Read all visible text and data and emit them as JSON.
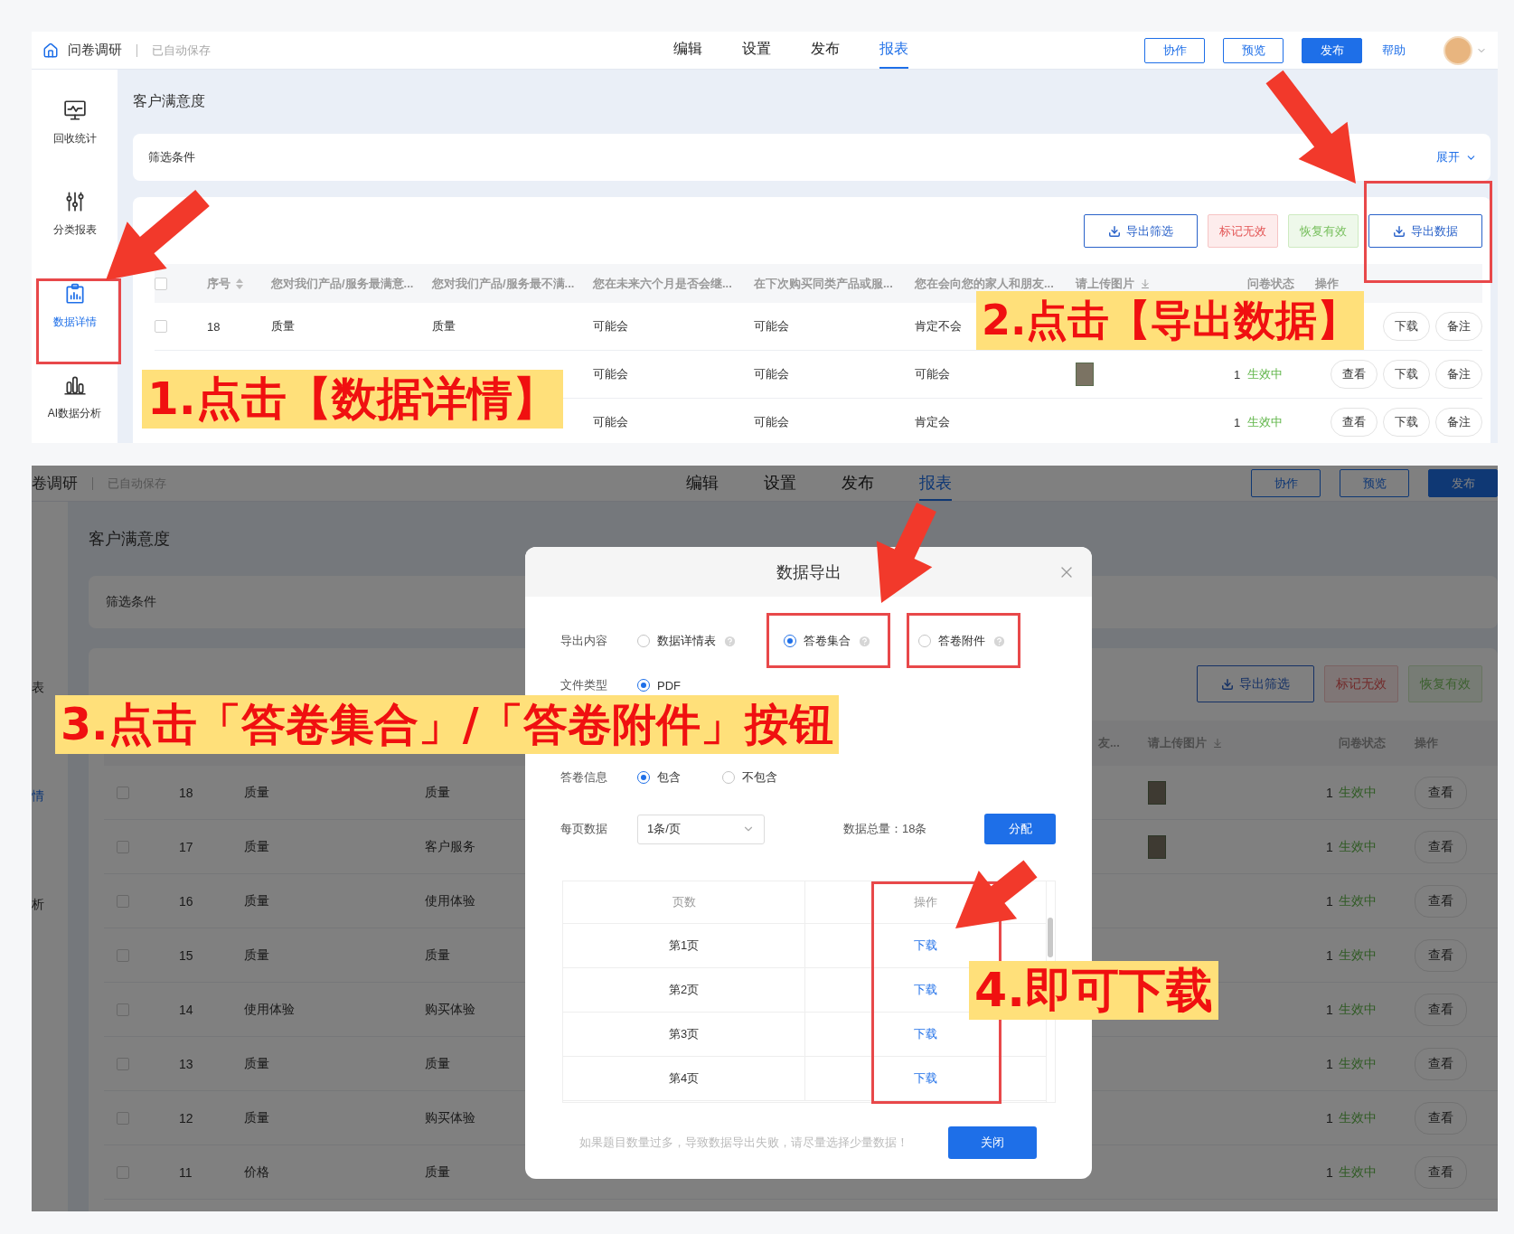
{
  "top_screen": {
    "header": {
      "home_icon": true,
      "title": "问卷调研",
      "autosave": "已自动保存",
      "tabs": [
        {
          "label": "编辑",
          "selected": false
        },
        {
          "label": "设置",
          "selected": false
        },
        {
          "label": "发布",
          "selected": false
        },
        {
          "label": "报表",
          "selected": true
        }
      ],
      "buttons": [
        {
          "label": "协作",
          "kind": "outline"
        },
        {
          "label": "预览",
          "kind": "outline"
        },
        {
          "label": "发布",
          "kind": "primary"
        },
        {
          "label": "帮助",
          "kind": "link"
        }
      ],
      "avatar": true
    },
    "sidebar": {
      "items": [
        {
          "label": "回收统计",
          "selected": false
        },
        {
          "label": "分类报表",
          "selected": false
        },
        {
          "label": "数据详情",
          "selected": true
        },
        {
          "label": "AI数据分析",
          "selected": false
        }
      ]
    },
    "page_title": "客户满意度",
    "filter": {
      "label": "筛选条件",
      "toggle": "展开"
    },
    "toolbar": [
      {
        "label": "导出筛选",
        "kind": "export"
      },
      {
        "label": "标记无效",
        "kind": "danger"
      },
      {
        "label": "恢复有效",
        "kind": "success"
      },
      {
        "label": "导出数据",
        "kind": "export"
      }
    ],
    "table": {
      "checked": false,
      "columns": [
        {
          "label": "序号",
          "kind": "sort"
        },
        {
          "label": "您对我们产品/服务最满意...",
          "kind": "text"
        },
        {
          "label": "您对我们产品/服务最不满...",
          "kind": "text"
        },
        {
          "label": "您在未来六个月是否会继...",
          "kind": "text"
        },
        {
          "label": "在下次购买同类产品或服...",
          "kind": "text"
        },
        {
          "label": "您在会向您的家人和朋友...",
          "kind": "text"
        },
        {
          "label": "请上传图片",
          "kind": "download"
        },
        {
          "label": "问卷状态",
          "kind": "text"
        },
        {
          "label": "操作",
          "kind": "text"
        }
      ],
      "rows": [
        {
          "checked": false,
          "cells": [
            "18",
            "质量",
            "质量",
            "可能会",
            "可能会",
            "肯定不会"
          ],
          "actions": [
            "下载",
            "备注"
          ]
        },
        {
          "cells": [
            null,
            null,
            null,
            "可能会",
            "可能会",
            "可能会"
          ],
          "photo": true,
          "count": "1",
          "status": "生效中",
          "actions": [
            "查看",
            "下载",
            "备注"
          ]
        },
        {
          "cells": [
            null,
            null,
            null,
            "可能会",
            "可能会",
            "肯定会"
          ],
          "count": "1",
          "status": "生效中",
          "actions": [
            "查看",
            "下载",
            "备注"
          ]
        }
      ]
    }
  },
  "bottom_screen": {
    "header": {
      "title": "卷调研",
      "autosave": "已自动保存",
      "tabs": [
        {
          "label": "编辑",
          "selected": false
        },
        {
          "label": "设置",
          "selected": false
        },
        {
          "label": "发布",
          "selected": false
        },
        {
          "label": "报表",
          "selected": true
        }
      ],
      "buttons": [
        {
          "label": "协作",
          "kind": "outline"
        },
        {
          "label": "预览",
          "kind": "outline"
        },
        {
          "label": "发布",
          "kind": "primary"
        }
      ]
    },
    "sidebar": {
      "items": [
        {
          "label": "表",
          "selected": false
        },
        {
          "label": "情",
          "selected": true
        },
        {
          "label": "析",
          "selected": false
        }
      ]
    },
    "page_title": "客户满意度",
    "filter": {
      "label": "筛选条件"
    },
    "toolbar": [
      {
        "label": "导出筛选",
        "kind": "export"
      },
      {
        "label": "标记无效",
        "kind": "danger"
      },
      {
        "label": "恢复有效",
        "kind": "success"
      }
    ],
    "table": {
      "columns": [
        {
          "label": "友...",
          "kind": "text"
        },
        {
          "label": "请上传图片",
          "kind": "download"
        },
        {
          "label": "问卷状态",
          "kind": "text"
        },
        {
          "label": "操作",
          "kind": "text"
        }
      ],
      "rows": [
        {
          "checked": false,
          "cells": [
            "18",
            "质量",
            "质量"
          ],
          "photo": true,
          "count": "1",
          "status": "生效中",
          "actions": [
            "查看"
          ]
        },
        {
          "checked": false,
          "cells": [
            "17",
            "质量",
            "客户服务"
          ],
          "photo": true,
          "count": "1",
          "status": "生效中",
          "actions": [
            "查看"
          ]
        },
        {
          "checked": false,
          "cells": [
            "16",
            "质量",
            "使用体验"
          ],
          "count": "1",
          "status": "生效中",
          "actions": [
            "查看"
          ]
        },
        {
          "checked": false,
          "cells": [
            "15",
            "质量",
            "质量"
          ],
          "count": "1",
          "status": "生效中",
          "actions": [
            "查看"
          ]
        },
        {
          "checked": false,
          "cells": [
            "14",
            "使用体验",
            "购买体验"
          ],
          "count": "1",
          "status": "生效中",
          "actions": [
            "查看"
          ]
        },
        {
          "checked": false,
          "cells": [
            "13",
            "质量",
            "质量"
          ],
          "count": "1",
          "status": "生效中",
          "actions": [
            "查看"
          ]
        },
        {
          "checked": false,
          "cells": [
            "12",
            "质量",
            "购买体验"
          ],
          "count": "1",
          "status": "生效中",
          "actions": [
            "查看"
          ]
        },
        {
          "checked": false,
          "cells": [
            "11",
            "价格",
            "质量"
          ],
          "count": "1",
          "status": "生效中",
          "actions": [
            "查看"
          ]
        }
      ]
    },
    "dialog": {
      "title": "数据导出",
      "export_content": {
        "label": "导出内容",
        "options": [
          {
            "label": "数据详情表",
            "selected": false
          },
          {
            "label": "答卷集合",
            "selected": true
          },
          {
            "label": "答卷附件",
            "selected": false
          }
        ]
      },
      "file_type": {
        "label": "文件类型",
        "options": [
          {
            "label": "PDF",
            "selected": true
          }
        ]
      },
      "answer_info": {
        "label": "答卷信息",
        "options": [
          {
            "label": "包含",
            "selected": true
          },
          {
            "label": "不包含",
            "selected": false
          }
        ]
      },
      "per_page": {
        "label": "每页数据",
        "value": "1条/页"
      },
      "total": "数据总量：18条",
      "assign_button": "分配",
      "pages": {
        "columns": [
          "页数",
          "操作"
        ],
        "rows": [
          {
            "page": "第1页",
            "action": "下载"
          },
          {
            "page": "第2页",
            "action": "下载"
          },
          {
            "page": "第3页",
            "action": "下载"
          },
          {
            "page": "第4页",
            "action": "下载"
          }
        ]
      },
      "hint": "如果题目数量过多，导致数据导出失败，请尽量选择少量数据！",
      "close_button": "关闭"
    }
  },
  "callouts": [
    "1.点击【数据详情】",
    "2.点击【导出数据】",
    "3.点击「答卷集合」/「答卷附件」按钮",
    "4.即可下载"
  ]
}
